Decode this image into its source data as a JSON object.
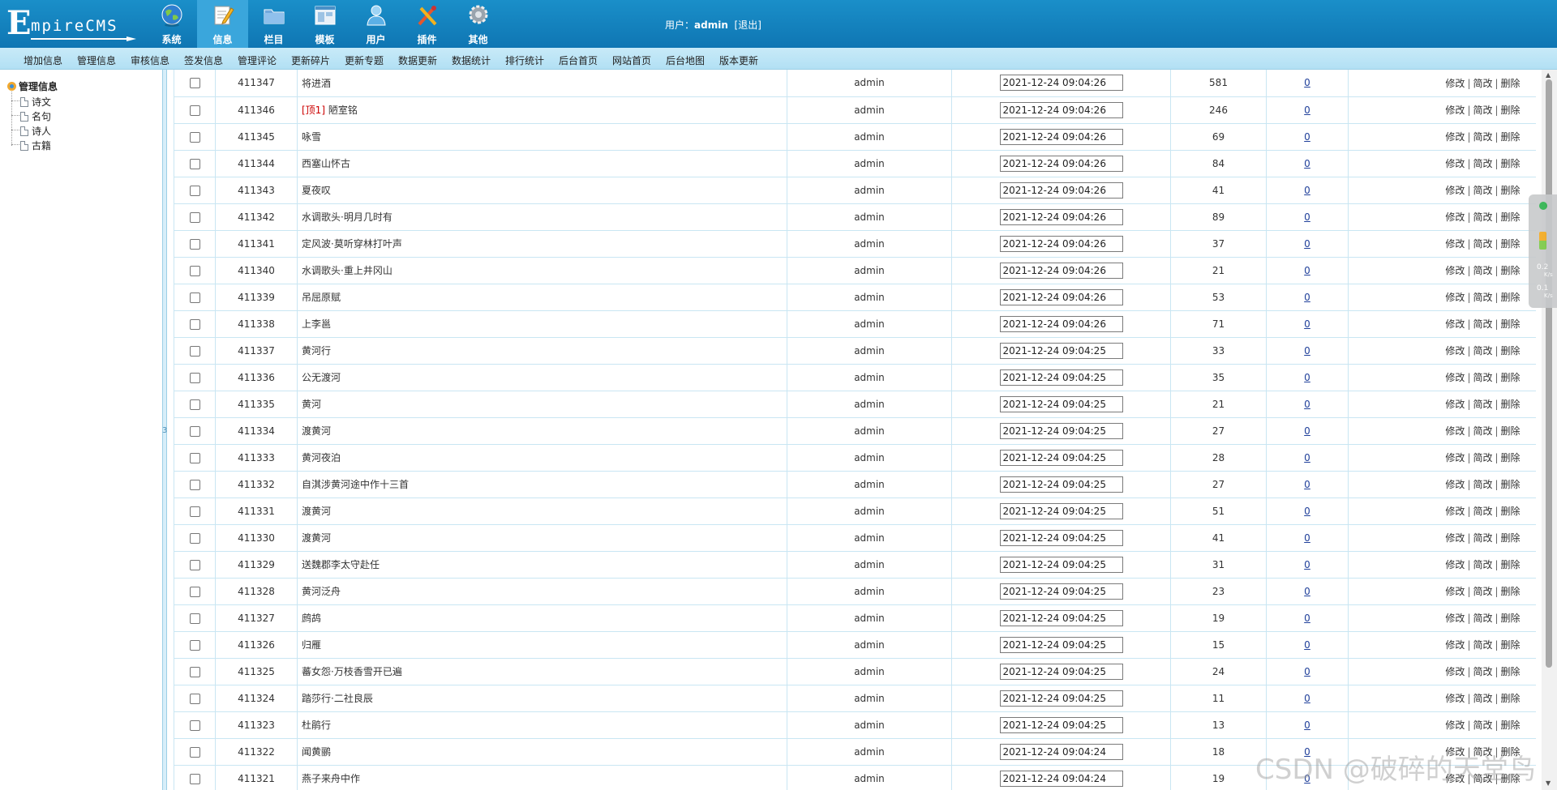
{
  "header": {
    "logo_big": "E",
    "logo_small": "mpireCMS",
    "nav": [
      {
        "label": "系统",
        "icon": "globe-icon"
      },
      {
        "label": "信息",
        "icon": "edit-document-icon",
        "active": true
      },
      {
        "label": "栏目",
        "icon": "folder-icon"
      },
      {
        "label": "模板",
        "icon": "template-window-icon"
      },
      {
        "label": "用户",
        "icon": "user-icon"
      },
      {
        "label": "插件",
        "icon": "tools-icon"
      },
      {
        "label": "其他",
        "icon": "gear-icon"
      }
    ],
    "user_label": "用户：",
    "username": "admin",
    "logout": "[退出]"
  },
  "subnav": [
    "增加信息",
    "管理信息",
    "审核信息",
    "签发信息",
    "管理评论",
    "更新碎片",
    "更新专题",
    "数据更新",
    "数据统计",
    "排行统计",
    "后台首页",
    "网站首页",
    "后台地图",
    "版本更新"
  ],
  "tree": {
    "root": "管理信息",
    "items": [
      "诗文",
      "名句",
      "诗人",
      "古籍"
    ]
  },
  "split_mark": "3",
  "ops": {
    "edit": "修改",
    "simple_edit": "简改",
    "delete": "删除",
    "sep": "|"
  },
  "rows": [
    {
      "id": "411347",
      "title": "将进酒",
      "user": "admin",
      "time": "2021-12-24 09:04:26",
      "hits": "581",
      "plnum": "0"
    },
    {
      "id": "411346",
      "top": "[顶1]",
      "title": " 陋室铭",
      "user": "admin",
      "time": "2021-12-24 09:04:26",
      "hits": "246",
      "plnum": "0"
    },
    {
      "id": "411345",
      "title": "咏雪",
      "user": "admin",
      "time": "2021-12-24 09:04:26",
      "hits": "69",
      "plnum": "0"
    },
    {
      "id": "411344",
      "title": "西塞山怀古",
      "user": "admin",
      "time": "2021-12-24 09:04:26",
      "hits": "84",
      "plnum": "0"
    },
    {
      "id": "411343",
      "title": "夏夜叹",
      "user": "admin",
      "time": "2021-12-24 09:04:26",
      "hits": "41",
      "plnum": "0"
    },
    {
      "id": "411342",
      "title": "水调歌头·明月几时有",
      "user": "admin",
      "time": "2021-12-24 09:04:26",
      "hits": "89",
      "plnum": "0"
    },
    {
      "id": "411341",
      "title": "定风波·莫听穿林打叶声",
      "user": "admin",
      "time": "2021-12-24 09:04:26",
      "hits": "37",
      "plnum": "0"
    },
    {
      "id": "411340",
      "title": "水调歌头·重上井冈山",
      "user": "admin",
      "time": "2021-12-24 09:04:26",
      "hits": "21",
      "plnum": "0"
    },
    {
      "id": "411339",
      "title": "吊屈原赋",
      "user": "admin",
      "time": "2021-12-24 09:04:26",
      "hits": "53",
      "plnum": "0"
    },
    {
      "id": "411338",
      "title": "上李邕",
      "user": "admin",
      "time": "2021-12-24 09:04:26",
      "hits": "71",
      "plnum": "0"
    },
    {
      "id": "411337",
      "title": "黄河行",
      "user": "admin",
      "time": "2021-12-24 09:04:25",
      "hits": "33",
      "plnum": "0"
    },
    {
      "id": "411336",
      "title": "公无渡河",
      "user": "admin",
      "time": "2021-12-24 09:04:25",
      "hits": "35",
      "plnum": "0"
    },
    {
      "id": "411335",
      "title": "黄河",
      "user": "admin",
      "time": "2021-12-24 09:04:25",
      "hits": "21",
      "plnum": "0"
    },
    {
      "id": "411334",
      "title": "渡黄河",
      "user": "admin",
      "time": "2021-12-24 09:04:25",
      "hits": "27",
      "plnum": "0"
    },
    {
      "id": "411333",
      "title": "黄河夜泊",
      "user": "admin",
      "time": "2021-12-24 09:04:25",
      "hits": "28",
      "plnum": "0"
    },
    {
      "id": "411332",
      "title": "自淇涉黄河途中作十三首",
      "user": "admin",
      "time": "2021-12-24 09:04:25",
      "hits": "27",
      "plnum": "0"
    },
    {
      "id": "411331",
      "title": "渡黄河",
      "user": "admin",
      "time": "2021-12-24 09:04:25",
      "hits": "51",
      "plnum": "0"
    },
    {
      "id": "411330",
      "title": "渡黄河",
      "user": "admin",
      "time": "2021-12-24 09:04:25",
      "hits": "41",
      "plnum": "0"
    },
    {
      "id": "411329",
      "title": "送魏郡李太守赴任",
      "user": "admin",
      "time": "2021-12-24 09:04:25",
      "hits": "31",
      "plnum": "0"
    },
    {
      "id": "411328",
      "title": "黄河泛舟",
      "user": "admin",
      "time": "2021-12-24 09:04:25",
      "hits": "23",
      "plnum": "0"
    },
    {
      "id": "411327",
      "title": "鹧鸪",
      "user": "admin",
      "time": "2021-12-24 09:04:25",
      "hits": "19",
      "plnum": "0"
    },
    {
      "id": "411326",
      "title": "归雁",
      "user": "admin",
      "time": "2021-12-24 09:04:25",
      "hits": "15",
      "plnum": "0"
    },
    {
      "id": "411325",
      "title": "蕃女怨·万枝香雪开已遍",
      "user": "admin",
      "time": "2021-12-24 09:04:25",
      "hits": "24",
      "plnum": "0"
    },
    {
      "id": "411324",
      "title": "踏莎行·二社良辰",
      "user": "admin",
      "time": "2021-12-24 09:04:25",
      "hits": "11",
      "plnum": "0"
    },
    {
      "id": "411323",
      "title": "杜鹃行",
      "user": "admin",
      "time": "2021-12-24 09:04:25",
      "hits": "13",
      "plnum": "0"
    },
    {
      "id": "411322",
      "title": "闻黄鹂",
      "user": "admin",
      "time": "2021-12-24 09:04:24",
      "hits": "18",
      "plnum": "0"
    },
    {
      "id": "411321",
      "title": "燕子来舟中作",
      "user": "admin",
      "time": "2021-12-24 09:04:24",
      "hits": "19",
      "plnum": "0"
    }
  ],
  "widget": {
    "up": "0.2",
    "up_unit": "K/s",
    "down": "0.1",
    "down_unit": "K/s"
  },
  "watermark": "CSDN @破碎的天堂鸟",
  "colors": {
    "header": "#1a8fc9",
    "active_tab": "#3aa6dc",
    "subnav": "#c8eaf8",
    "top_tag": "#cc0000",
    "link": "#1f3f9a"
  }
}
